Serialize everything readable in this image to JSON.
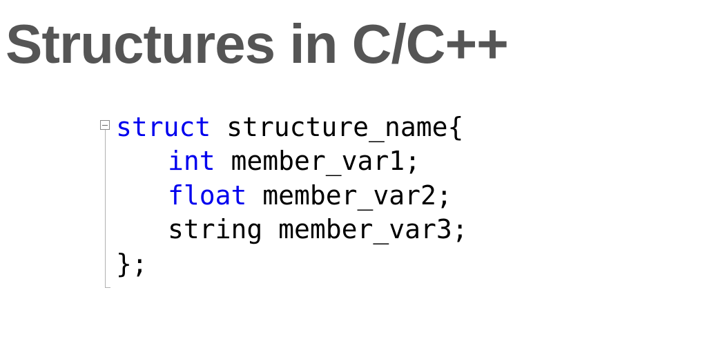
{
  "title": "Structures in C/C++",
  "code": {
    "line1_kw": "struct",
    "line1_rest": " structure_name{",
    "line2_kw": "int",
    "line2_rest": " member_var1;",
    "line3_kw": "float",
    "line3_rest": " member_var2;",
    "line4": "string member_var3;",
    "line5": "};"
  }
}
